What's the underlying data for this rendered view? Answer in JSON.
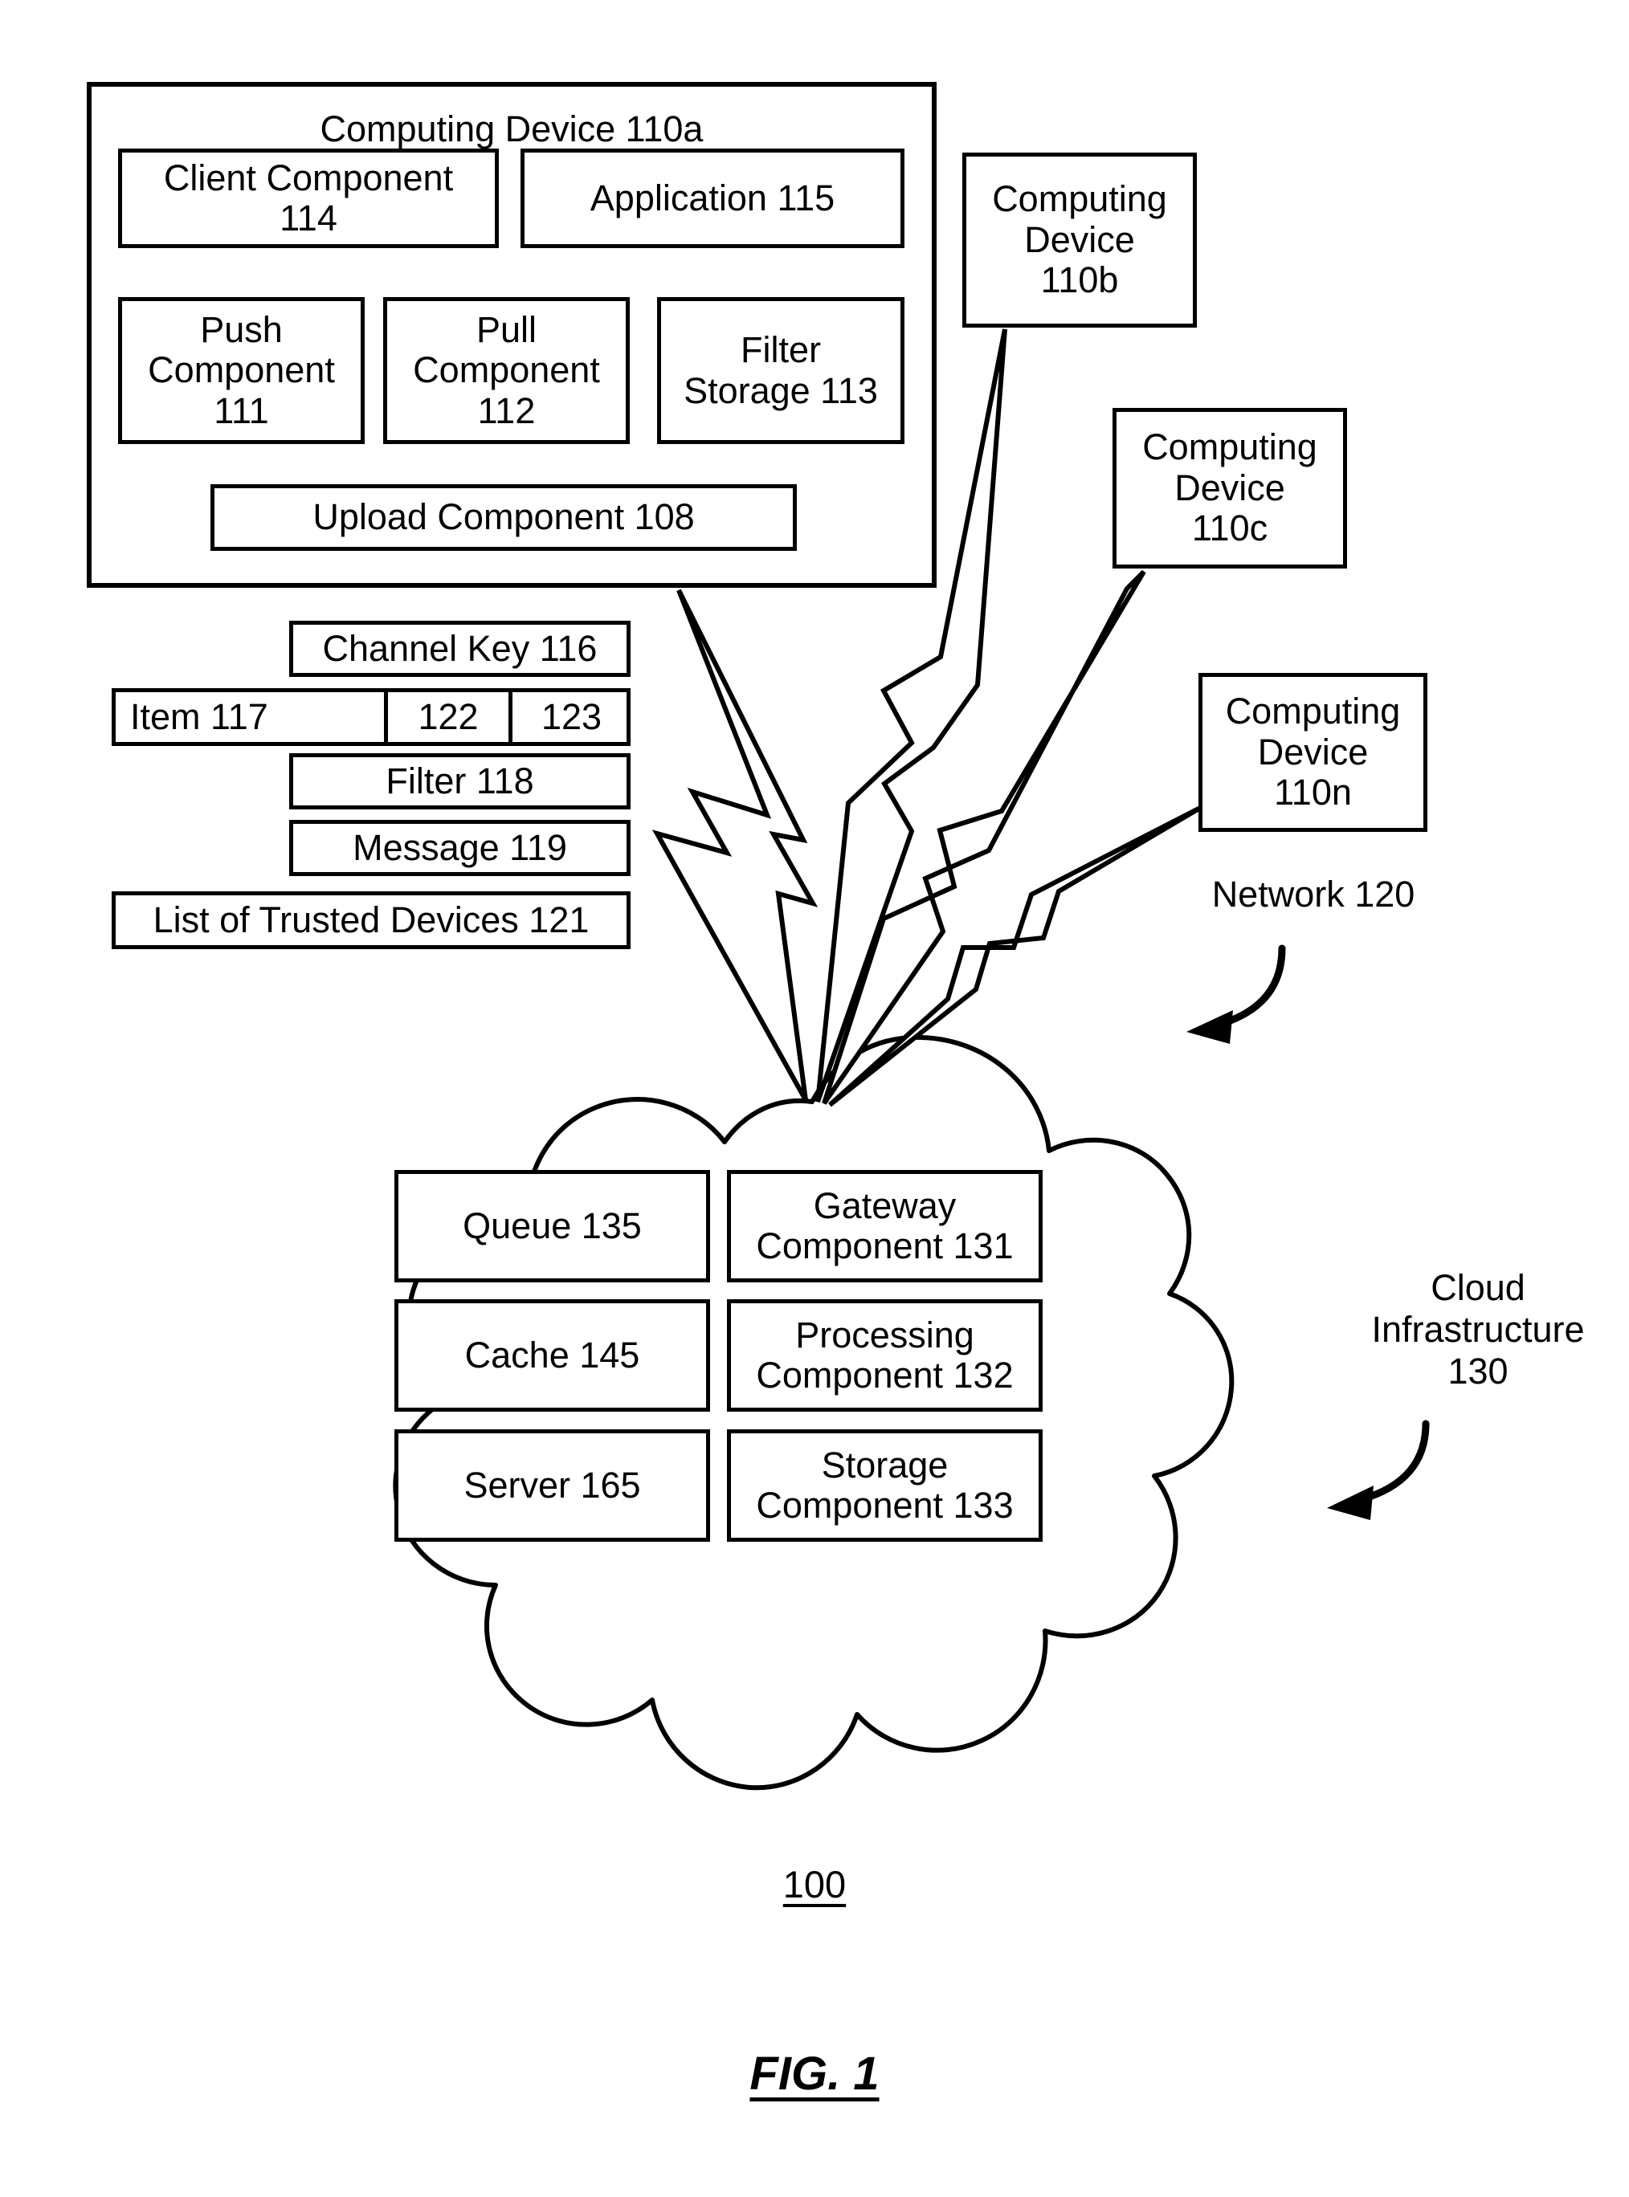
{
  "figure": {
    "caption": "FIG. 1",
    "reference_numeral": "100"
  },
  "device_110a": {
    "title": "Computing Device 110a",
    "components": [
      {
        "name": "client-component",
        "label": "Client Component\n114"
      },
      {
        "name": "application",
        "label": "Application 115"
      },
      {
        "name": "push-component",
        "label": "Push\nComponent\n111"
      },
      {
        "name": "pull-component",
        "label": "Pull\nComponent\n112"
      },
      {
        "name": "filter-storage",
        "label": "Filter\nStorage 113"
      },
      {
        "name": "upload-component",
        "label": "Upload Component 108"
      }
    ]
  },
  "data_items": {
    "channel_key": "Channel Key 116",
    "item_row": {
      "item": "Item 117",
      "field_122": "122",
      "field_123": "123"
    },
    "filter": "Filter 118",
    "message": "Message 119",
    "trusted_devices": "List of Trusted Devices 121"
  },
  "other_devices": [
    {
      "name": "device-110b",
      "label": "Computing\nDevice\n110b"
    },
    {
      "name": "device-110c",
      "label": "Computing\nDevice\n110c"
    },
    {
      "name": "device-110n",
      "label": "Computing\nDevice\n110n"
    }
  ],
  "network": {
    "label": "Network 120"
  },
  "cloud": {
    "label": "Cloud\nInfrastructure\n130",
    "components": [
      {
        "name": "queue",
        "label": "Queue 135"
      },
      {
        "name": "gateway-component",
        "label": "Gateway\nComponent 131"
      },
      {
        "name": "cache",
        "label": "Cache 145"
      },
      {
        "name": "processing-component",
        "label": "Processing\nComponent 132"
      },
      {
        "name": "server",
        "label": "Server 165"
      },
      {
        "name": "storage-component",
        "label": "Storage\nComponent 133"
      }
    ]
  },
  "style": {
    "stroke": "#000000",
    "background": "#ffffff"
  }
}
